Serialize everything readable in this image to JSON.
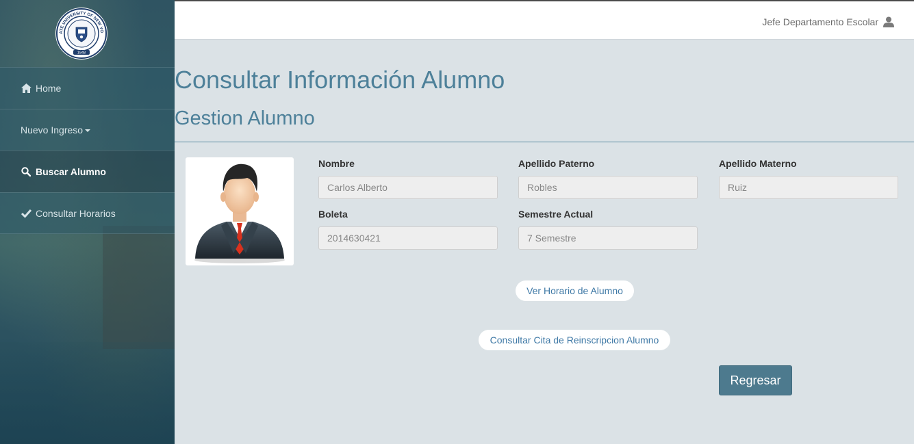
{
  "sidebar": {
    "logo": {
      "name": "university-seal",
      "text_ring": "STATE UNIVERSITY OF NEW YORK",
      "motto": "TO LEARN · TO SEARCH · TO SERVE",
      "year": "1948"
    },
    "items": [
      {
        "label": "Home",
        "icon": "home-icon",
        "active": false
      },
      {
        "label": "Nuevo Ingreso",
        "icon": "",
        "active": false,
        "dropdown": true
      },
      {
        "label": "Buscar Alumno",
        "icon": "search-icon",
        "active": true
      },
      {
        "label": "Consultar Horarios",
        "icon": "check-icon",
        "active": false
      }
    ]
  },
  "header": {
    "user_label": "Jefe Departamento Escolar",
    "user_icon": "user-icon"
  },
  "main": {
    "title": "Consultar Información Alumno",
    "subtitle": "Gestion Alumno",
    "photo": {
      "icon": "student-avatar-icon"
    },
    "fields": {
      "nombre": {
        "label": "Nombre",
        "value": "Carlos Alberto"
      },
      "apellido_paterno": {
        "label": "Apellido Paterno",
        "value": "Robles"
      },
      "apellido_materno": {
        "label": "Apellido Materno",
        "value": "Ruiz"
      },
      "boleta": {
        "label": "Boleta",
        "value": "2014630421"
      },
      "semestre": {
        "label": "Semestre Actual",
        "value": "7 Semestre"
      }
    },
    "buttons": {
      "ver_horario": "Ver Horario de Alumno",
      "consultar_cita": "Consultar Cita de Reinscripcion Alumno",
      "regresar": "Regresar"
    }
  },
  "colors": {
    "sidebar_bg": "#2f5462",
    "content_bg": "#dbe2e6",
    "title": "#4d8099",
    "link": "#3f79a6",
    "primary_button": "#4d7a8e"
  }
}
